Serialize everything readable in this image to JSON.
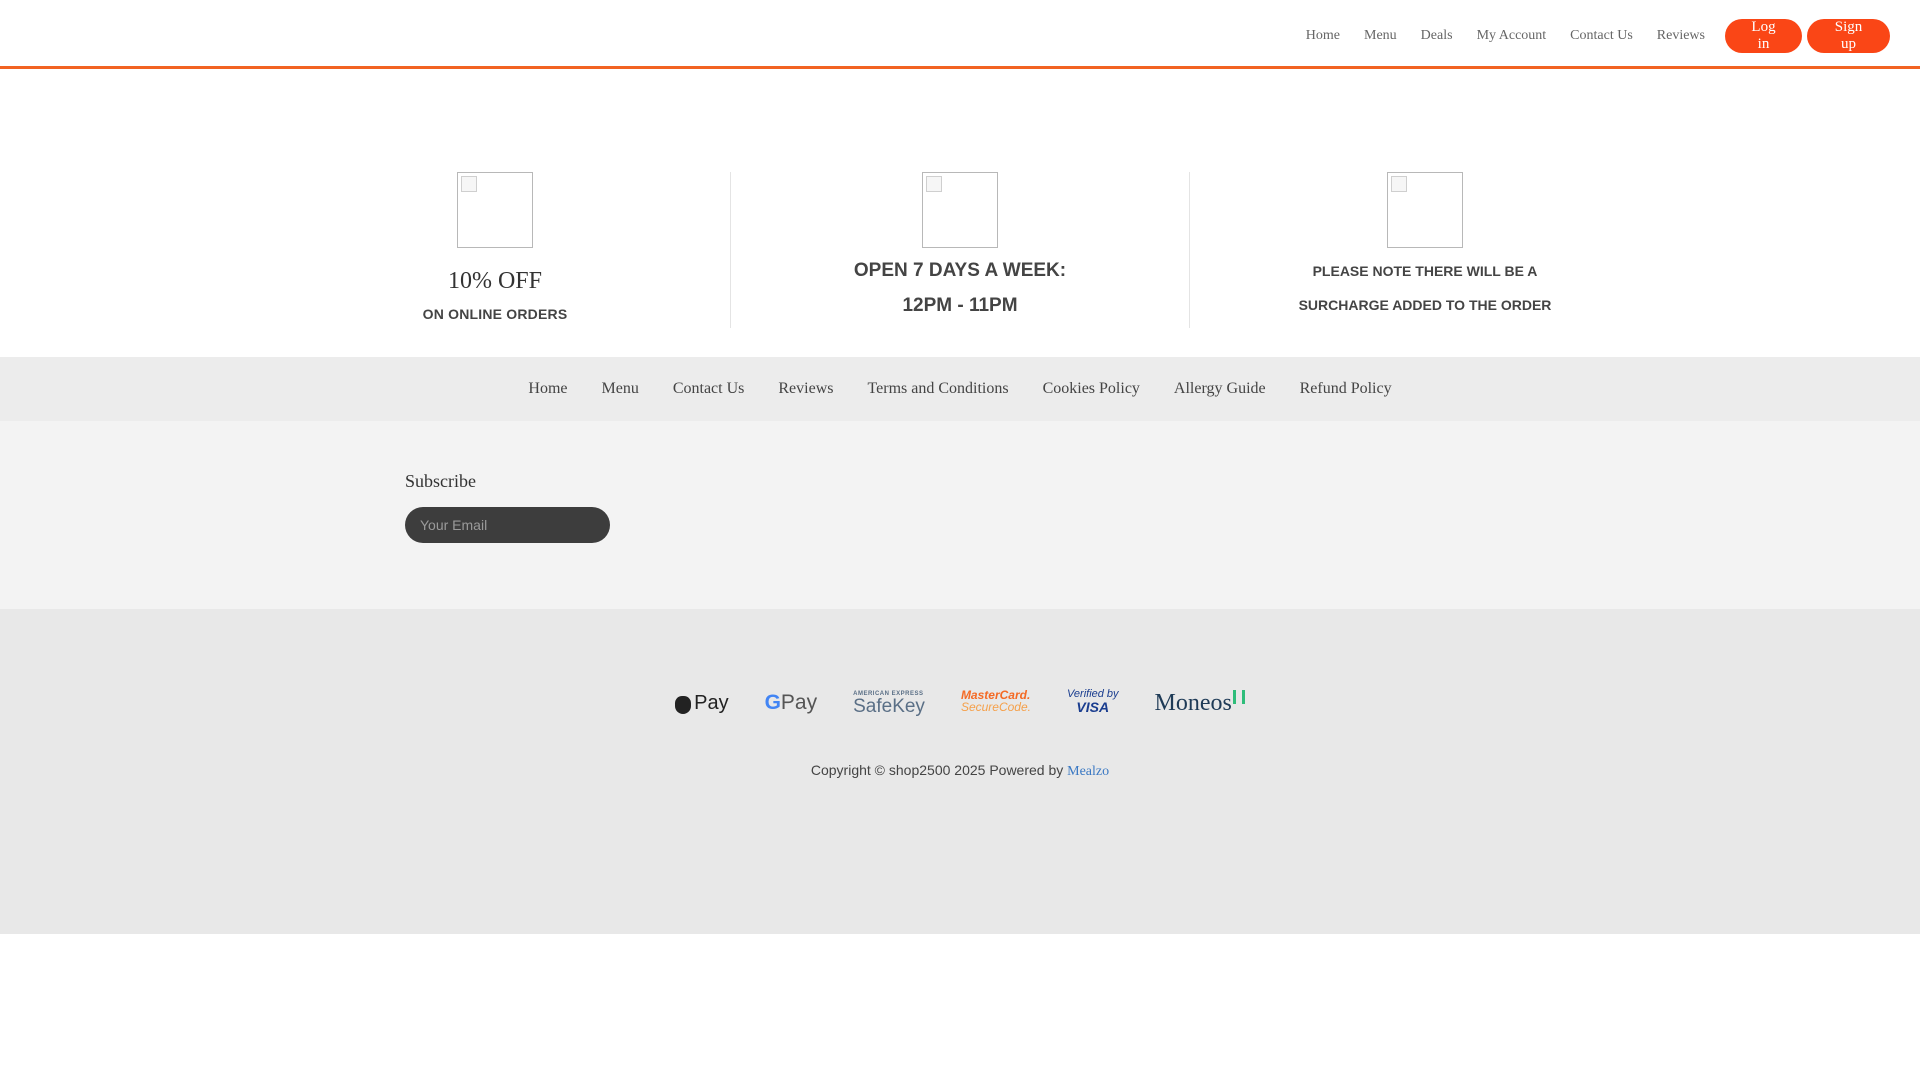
{
  "header": {
    "nav": [
      "Home",
      "Menu",
      "Deals",
      "My Account",
      "Contact Us",
      "Reviews"
    ],
    "login_label": "Log in",
    "signup_label": "Sign up",
    "accent_color": "#fa4616"
  },
  "info": {
    "discount_title": "10% OFF",
    "discount_subtitle": "ON ONLINE ORDERS",
    "hours_line1": "OPEN 7 DAYS A WEEK:",
    "hours_line2": "12PM - 11PM",
    "note_line1": "PLEASE NOTE THERE WILL BE A",
    "note_line2": "SURCHARGE ADDED TO THE ORDER"
  },
  "footer_nav": [
    "Home",
    "Menu",
    "Contact Us",
    "Reviews",
    "Terms and Conditions",
    "Cookies Policy",
    "Allergy Guide",
    "Refund Policy"
  ],
  "subscribe": {
    "title": "Subscribe",
    "placeholder": "Your Email"
  },
  "payments": {
    "apple_pay": "Pay",
    "google_pay": "Pay",
    "google_g": "G",
    "amex_top": "AMERICAN EXPRESS",
    "amex_main": "SafeKey",
    "mastercard_line1": "MasterCard.",
    "mastercard_line2": "SecureCode.",
    "visa_line1": "Verified by",
    "visa_line2": "VISA",
    "moneos": "Moneos"
  },
  "copyright": {
    "text": "Copyright © shop2500 2025 Powered by",
    "link": "Mealzo"
  }
}
